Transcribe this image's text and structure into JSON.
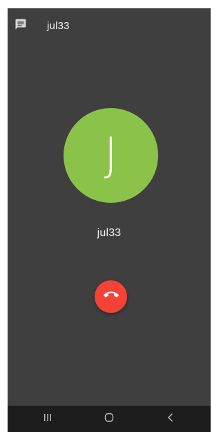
{
  "header": {
    "name": "jul33",
    "chat_icon": "message-icon"
  },
  "caller": {
    "initial": "J",
    "name": "jul33",
    "avatar_color": "#8bc34a"
  },
  "call_controls": {
    "end_call_icon": "phone-hangup-icon",
    "end_call_color": "#f44336"
  },
  "navigation": {
    "recents_icon": "recent-apps-icon",
    "home_icon": "home-icon",
    "back_icon": "back-icon"
  },
  "colors": {
    "background": "#3f3f3f",
    "nav_background": "#1d1d1d"
  }
}
